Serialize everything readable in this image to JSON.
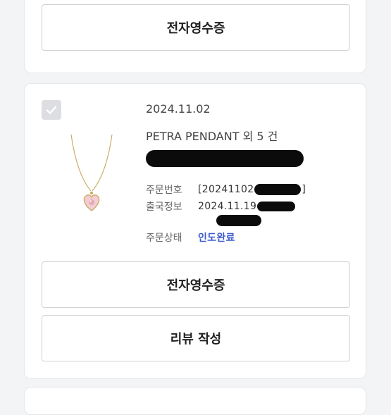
{
  "top_card": {
    "receipt_label": "전자영수증"
  },
  "order": {
    "date": "2024.11.02",
    "product_name": "PETRA PENDANT 외 5 건",
    "order_number_label": "주문번호",
    "order_number_value": "[20241102",
    "order_number_suffix": "]",
    "shipping_label": "출국정보",
    "shipping_value": "2024.11.19",
    "status_label": "주문상태",
    "status_value": "인도완료",
    "receipt_label": "전자영수증",
    "review_label": "리뷰 작성"
  },
  "colors": {
    "status_accent": "#3b5bcc",
    "background": "#f3f4f6",
    "checkbox": "#dcdee2"
  },
  "icons": {
    "checkbox": "check-icon",
    "product": "necklace-pendant-image"
  }
}
